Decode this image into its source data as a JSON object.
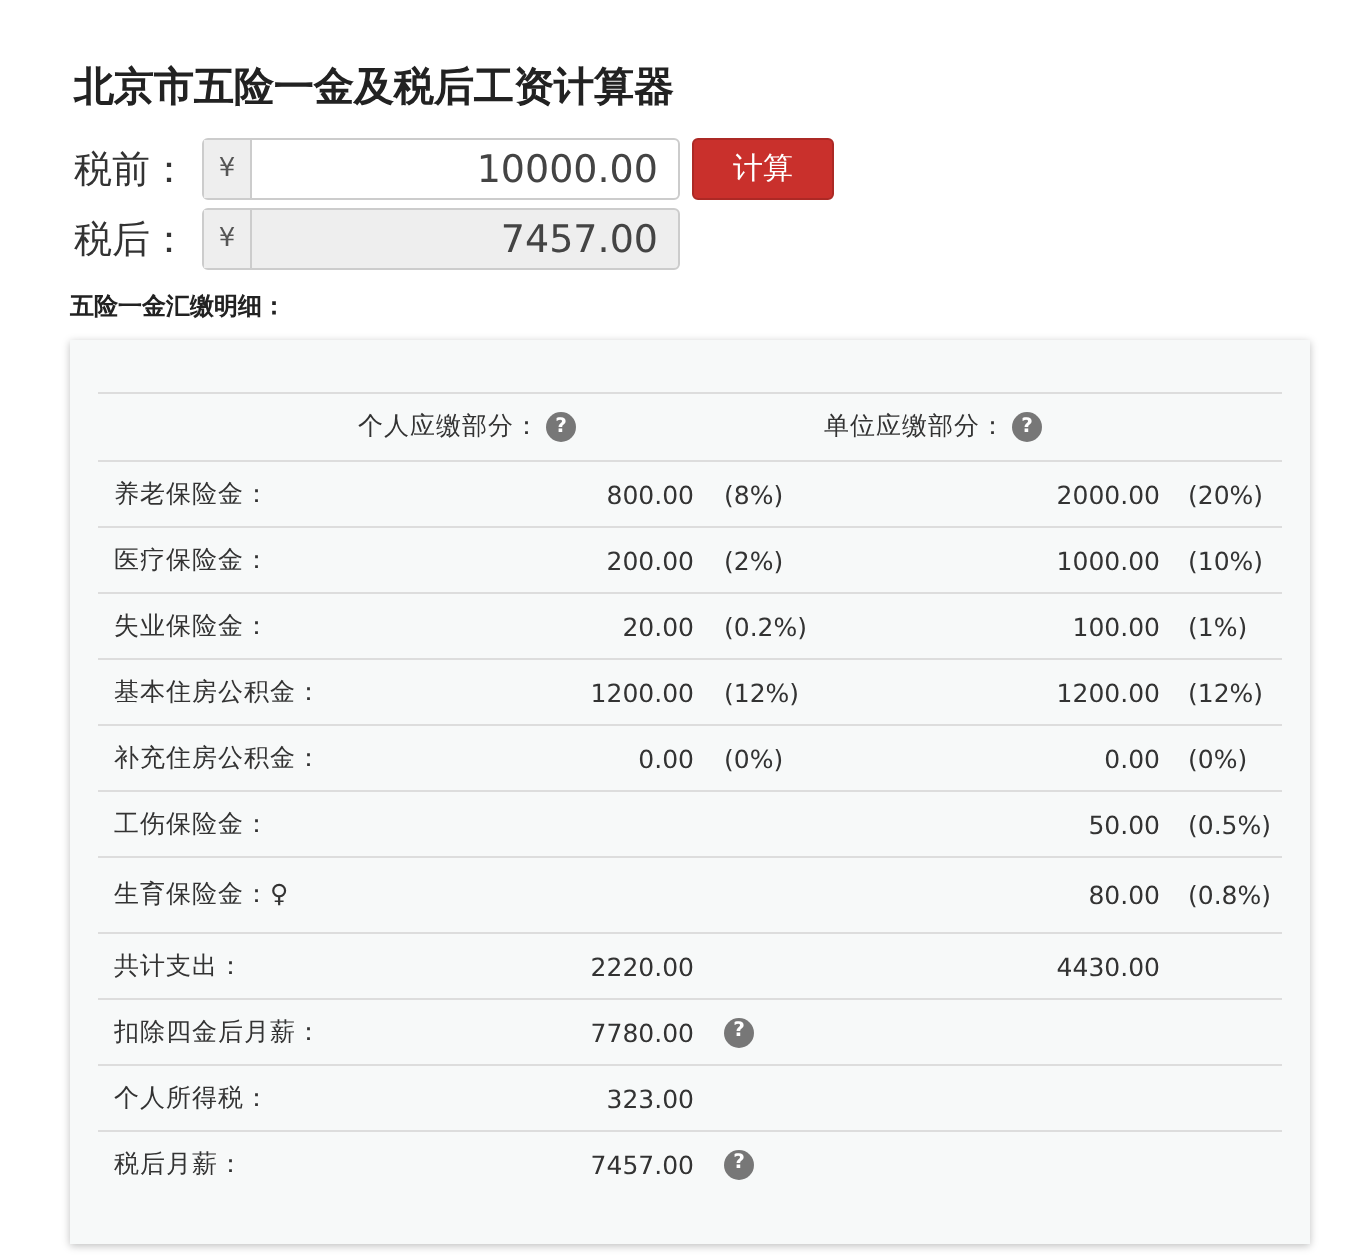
{
  "title": "北京市五险一金及税后工资计算器",
  "pre_tax": {
    "label": "税前：",
    "currency": "¥",
    "value": "10000.00"
  },
  "calc_button": "计算",
  "after_tax": {
    "label": "税后：",
    "currency": "¥",
    "value": "7457.00"
  },
  "section_title": "五险一金汇缴明细：",
  "table": {
    "headers": [
      {
        "label": "个人应缴部分：",
        "help": "?"
      },
      {
        "label": "单位应缴部分：",
        "help": "?"
      }
    ],
    "rows": [
      {
        "label": "养老保险金：",
        "personal": "800.00",
        "personal_rate": "(8%)",
        "company": "2000.00",
        "company_rate": "(20%)"
      },
      {
        "label": "医疗保险金：",
        "personal": "200.00",
        "personal_rate": "(2%)",
        "company": "1000.00",
        "company_rate": "(10%)"
      },
      {
        "label": "失业保险金：",
        "personal": "20.00",
        "personal_rate": "(0.2%)",
        "company": "100.00",
        "company_rate": "(1%)"
      },
      {
        "label": "基本住房公积金：",
        "personal": "1200.00",
        "personal_rate": "(12%)",
        "company": "1200.00",
        "company_rate": "(12%)"
      },
      {
        "label": "补充住房公积金：",
        "personal": "0.00",
        "personal_rate": "(0%)",
        "company": "0.00",
        "company_rate": "(0%)"
      },
      {
        "label": "工伤保险金：",
        "company": "50.00",
        "company_rate": "(0.5%)"
      },
      {
        "label": "生育保险金：♀",
        "company": "80.00",
        "company_rate": "(0.8%)"
      },
      {
        "label": "共计支出：",
        "personal": "2220.00",
        "company": "4430.00"
      },
      {
        "label": "扣除四金后月薪：",
        "personal": "7780.00",
        "help": "?"
      },
      {
        "label": "个人所得税：",
        "personal": "323.00"
      },
      {
        "label": "税后月薪：",
        "personal": "7457.00",
        "help": "?"
      }
    ]
  }
}
